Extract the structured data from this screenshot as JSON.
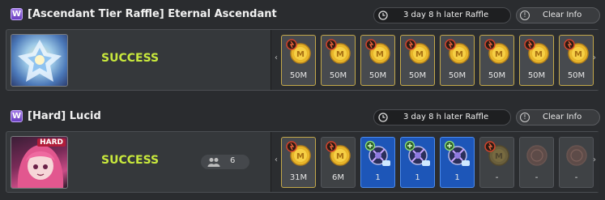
{
  "sections": [
    {
      "category_badge": "W",
      "title": "[Ascendant Tier Raffle] Eternal Ascendant",
      "raffle_text": "3 day 8 h later Raffle",
      "clear_label": "Clear Info",
      "status": "SUCCESS",
      "party_count": null,
      "items": [
        {
          "type": "gold",
          "icon": "coin-icon",
          "label": "50M"
        },
        {
          "type": "gold",
          "icon": "coin-icon",
          "label": "50M"
        },
        {
          "type": "gold",
          "icon": "coin-icon",
          "label": "50M"
        },
        {
          "type": "gold",
          "icon": "coin-icon",
          "label": "50M"
        },
        {
          "type": "gold",
          "icon": "coin-icon",
          "label": "50M"
        },
        {
          "type": "gold",
          "icon": "coin-icon",
          "label": "50M"
        },
        {
          "type": "gold",
          "icon": "coin-icon",
          "label": "50M"
        },
        {
          "type": "gold",
          "icon": "coin-icon",
          "label": "50M"
        }
      ]
    },
    {
      "category_badge": "W",
      "title": "[Hard] Lucid",
      "difficulty_tag": "HARD",
      "raffle_text": "3 day 8 h later Raffle",
      "clear_label": "Clear Info",
      "status": "SUCCESS",
      "party_count": "6",
      "items": [
        {
          "type": "gold",
          "icon": "coin-icon",
          "label": "31M"
        },
        {
          "type": "dark",
          "icon": "coin-icon",
          "label": "6M"
        },
        {
          "type": "blue",
          "icon": "crystal-icon",
          "label": "1"
        },
        {
          "type": "blue",
          "icon": "crystal-icon",
          "label": "1"
        },
        {
          "type": "blue",
          "icon": "crystal-icon",
          "label": "1"
        },
        {
          "type": "empty",
          "icon": "coin-icon",
          "label": "-"
        },
        {
          "type": "empty",
          "icon": "emblem-icon",
          "label": "-"
        },
        {
          "type": "empty",
          "icon": "emblem-icon",
          "label": "-"
        }
      ]
    }
  ],
  "colors": {
    "status_success": "#c8e83c",
    "gold_border": "#c3a84a",
    "blue_slot": "#1d56b8"
  }
}
